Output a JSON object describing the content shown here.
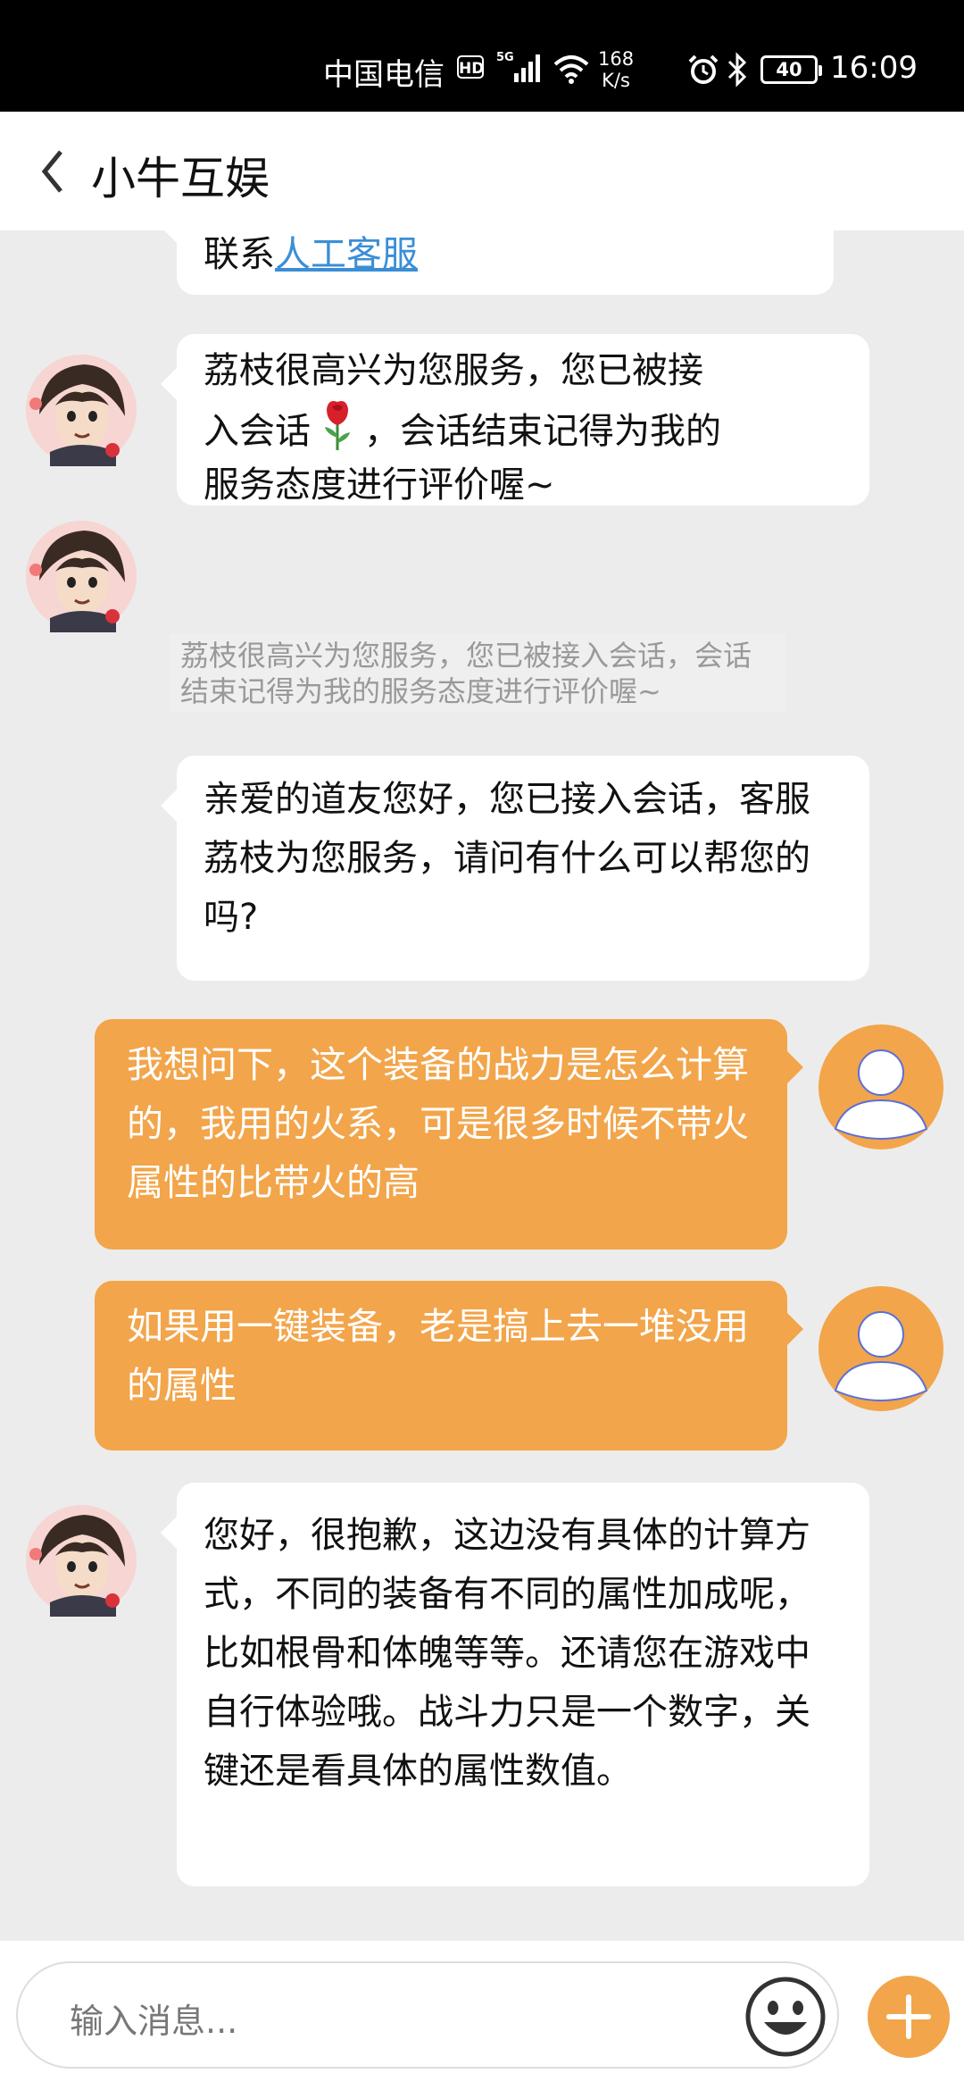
{
  "status_bar": {
    "carrier": "中国电信",
    "hd": "HD",
    "network": "5G",
    "speed_value": "168",
    "speed_unit": "K/s",
    "battery": "40",
    "time": "16:09"
  },
  "header": {
    "title": "小牛互娱"
  },
  "messages": {
    "m0_prefix": "联系",
    "m0_link": "人工客服",
    "m1_line1": "荔枝很高兴为您服务，您已被接",
    "m1_line2a": "入会话",
    "m1_line2b": "，会话结束记得为我的",
    "m1_line3": "服务态度进行评价喔~",
    "system_note": "荔枝很高兴为您服务，您已被接入会话，会话结束记得为我的服务态度进行评价喔~",
    "m2": "亲爱的道友您好，您已接入会话，客服荔枝为您服务，请问有什么可以帮您的吗?",
    "u1": "我想问下，这个装备的战力是怎么计算的，我用的火系，可是很多时候不带火属性的比带火的高",
    "u2": "如果用一键装备，老是搞上去一堆没用的属性",
    "m3": "您好，很抱歉，这边没有具体的计算方式，不同的装备有不同的属性加成呢，比如根骨和体魄等等。还请您在游戏中自行体验哦。战斗力只是一个数字，关键还是看具体的属性数值。"
  },
  "input": {
    "placeholder": "输入消息..."
  },
  "icons": {
    "back": "chevron-left-icon",
    "rose": "rose-icon",
    "emoji": "smiley-icon",
    "plus": "plus-icon",
    "user_avatar": "person-icon",
    "bot_avatar": "character-avatar"
  },
  "colors": {
    "accent": "#f2a54a",
    "link": "#3b8ed6"
  }
}
